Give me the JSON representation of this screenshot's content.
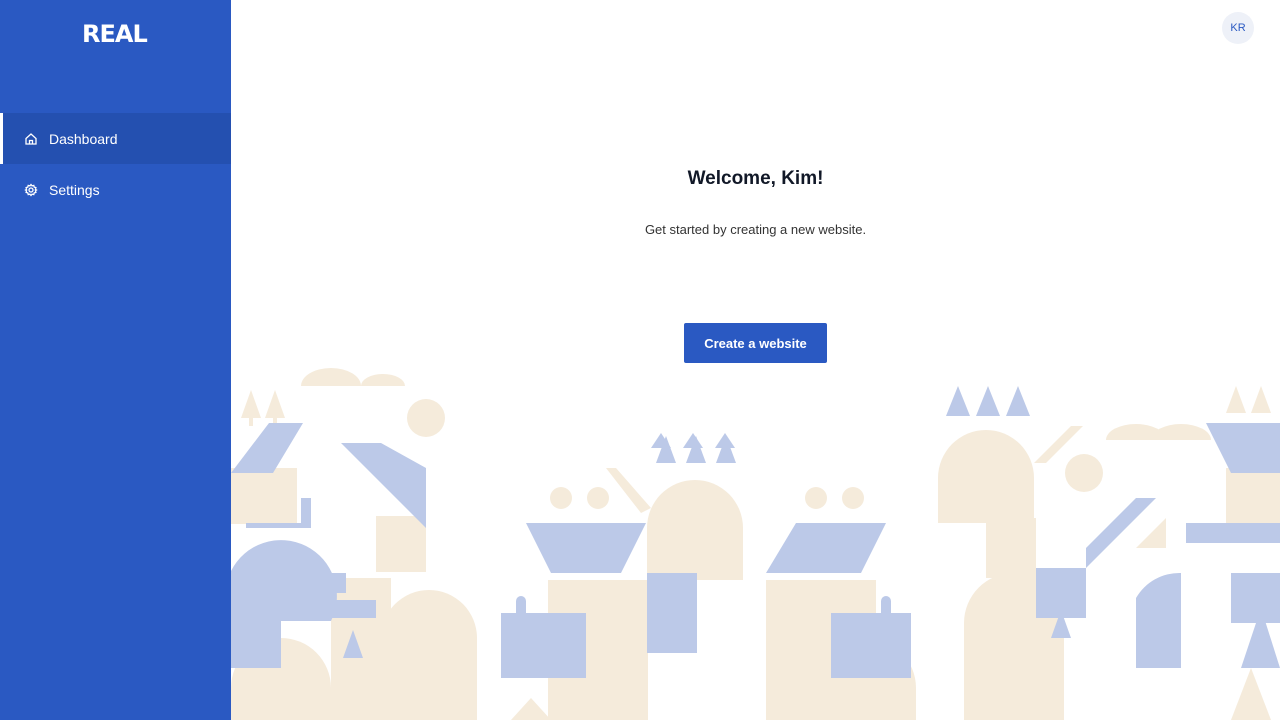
{
  "app": {
    "logo_text": "REAL"
  },
  "sidebar": {
    "items": [
      {
        "label": "Dashboard",
        "icon": "home-icon",
        "active": true
      },
      {
        "label": "Settings",
        "icon": "gear-icon",
        "active": false
      }
    ]
  },
  "header": {
    "avatar_initials": "KR"
  },
  "main": {
    "welcome": "Welcome, Kim!",
    "subtitle": "Get started by creating a new website.",
    "create_button": "Create a website"
  },
  "colors": {
    "sidebar": "#2a59c2",
    "sidebar_active": "#2450b0",
    "button": "#2a59c2",
    "illustration_blue": "#bcc9e8",
    "illustration_beige": "#f5ebdb"
  }
}
